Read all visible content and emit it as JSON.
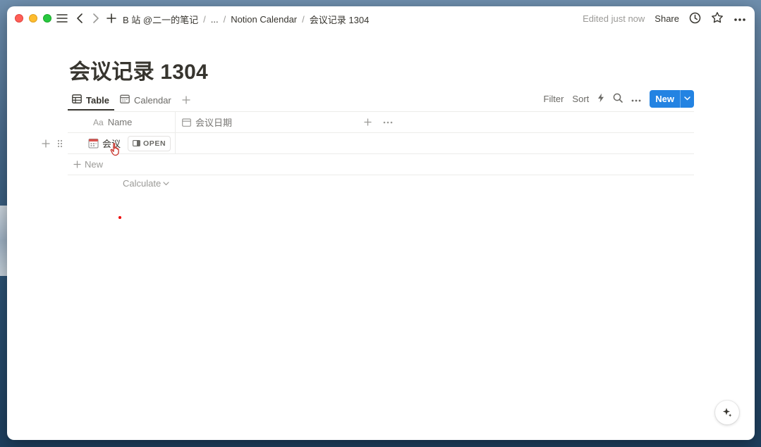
{
  "breadcrumb": {
    "items": [
      "B 站 @二一的笔记",
      "...",
      "Notion Calendar",
      "会议记录 1304"
    ],
    "separator": "/"
  },
  "topbar": {
    "edited": "Edited just now",
    "share": "Share"
  },
  "page": {
    "title": "会议记录 1304"
  },
  "views": {
    "tabs": [
      {
        "label": "Table",
        "icon": "table-icon",
        "active": true
      },
      {
        "label": "Calendar",
        "icon": "calendar-icon",
        "active": false
      }
    ],
    "tools": {
      "filter": "Filter",
      "sort": "Sort",
      "new": "New"
    }
  },
  "table": {
    "columns": [
      {
        "prefix": "Aa",
        "label": "Name",
        "icon": "text-icon"
      },
      {
        "label": "会议日期",
        "icon": "calendar-icon"
      }
    ],
    "rows": [
      {
        "name": "会议",
        "icon": "calendar-emoji-icon",
        "open_label": "OPEN"
      }
    ],
    "new_label": "New",
    "calculate_label": "Calculate"
  },
  "colors": {
    "accent": "#2383e2",
    "text": "#37352f",
    "muted": "#9b9a97"
  }
}
